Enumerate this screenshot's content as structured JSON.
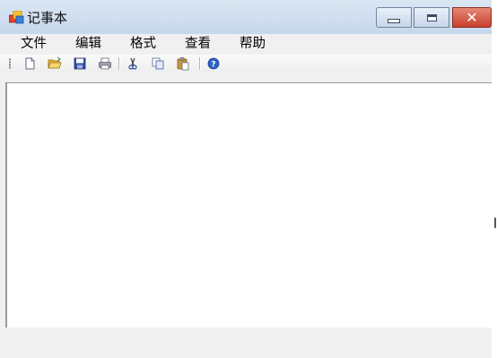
{
  "window": {
    "title": "记事本"
  },
  "menu": {
    "items": [
      {
        "label": "文件"
      },
      {
        "label": "编辑"
      },
      {
        "label": "格式"
      },
      {
        "label": "查看"
      },
      {
        "label": "帮助"
      }
    ]
  },
  "toolbar": {
    "buttons": [
      {
        "icon": "new-document-icon"
      },
      {
        "icon": "open-folder-icon"
      },
      {
        "icon": "save-icon"
      },
      {
        "icon": "print-icon"
      },
      {
        "icon": "cut-icon"
      },
      {
        "icon": "copy-icon"
      },
      {
        "icon": "paste-icon"
      },
      {
        "icon": "help-icon"
      }
    ]
  },
  "editor": {
    "content": ""
  },
  "colors": {
    "titlebar": "#c6d7ec",
    "close_button": "#c73f2c",
    "chrome": "#f0f0f0",
    "help_blue": "#2a62c9"
  }
}
